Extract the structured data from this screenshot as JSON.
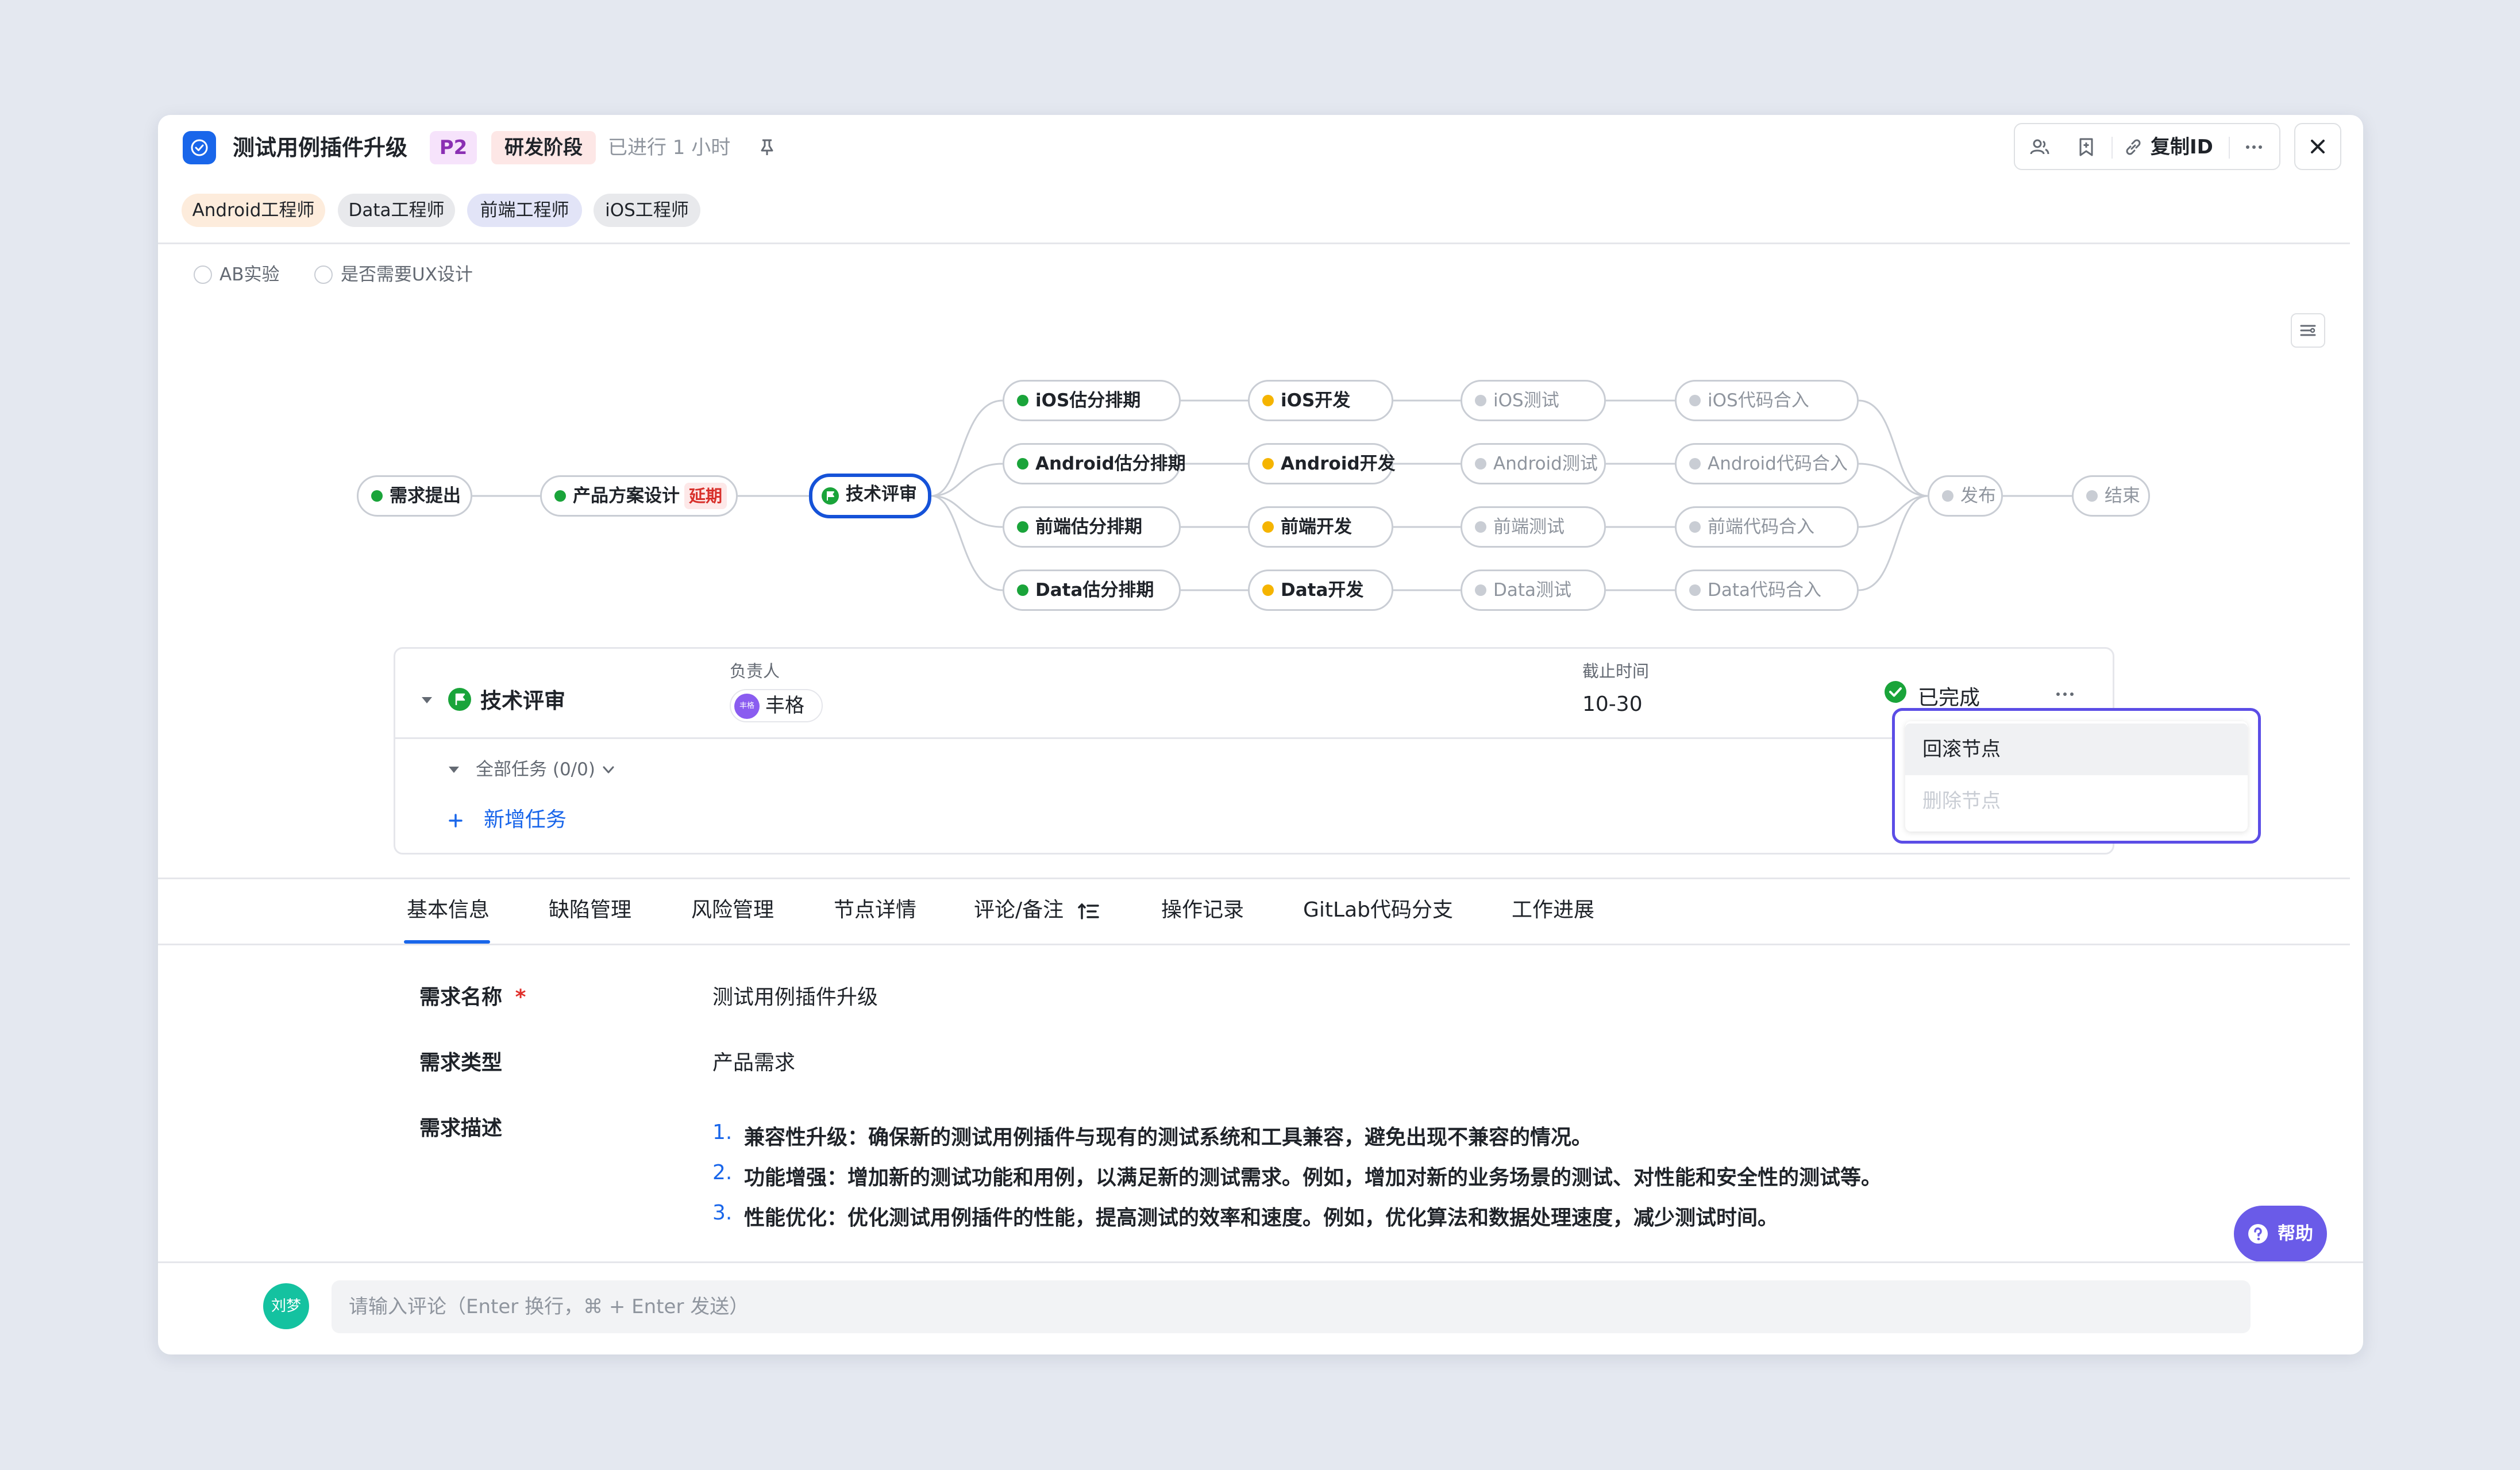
{
  "header": {
    "title": "测试用例插件升级",
    "priority": "P2",
    "stage": "研发阶段",
    "elapsed": "已进行 1 小时",
    "copy_id_label": "复制ID"
  },
  "role_tags": [
    "Android工程师",
    "Data工程师",
    "前端工程师",
    "iOS工程师"
  ],
  "options": {
    "ab_test": "AB实验",
    "ux_design": "是否需要UX设计"
  },
  "flow": {
    "nodes": [
      {
        "label": "需求提出",
        "status": "done"
      },
      {
        "label": "产品方案设计",
        "status": "done",
        "tag": "延期"
      },
      {
        "label": "技术评审",
        "status": "current"
      },
      {
        "label": "iOS估分排期",
        "status": "done"
      },
      {
        "label": "Android估分排期",
        "status": "done"
      },
      {
        "label": "前端估分排期",
        "status": "done"
      },
      {
        "label": "Data估分排期",
        "status": "done"
      },
      {
        "label": "iOS开发",
        "status": "in-progress"
      },
      {
        "label": "Android开发",
        "status": "in-progress"
      },
      {
        "label": "前端开发",
        "status": "in-progress"
      },
      {
        "label": "Data开发",
        "status": "in-progress"
      },
      {
        "label": "iOS测试",
        "status": "pending"
      },
      {
        "label": "Android测试",
        "status": "pending"
      },
      {
        "label": "前端测试",
        "status": "pending"
      },
      {
        "label": "Data测试",
        "status": "pending"
      },
      {
        "label": "iOS代码合入",
        "status": "pending"
      },
      {
        "label": "Android代码合入",
        "status": "pending"
      },
      {
        "label": "前端代码合入",
        "status": "pending"
      },
      {
        "label": "Data代码合入",
        "status": "pending"
      },
      {
        "label": "发布",
        "status": "pending"
      },
      {
        "label": "结束",
        "status": "pending"
      }
    ],
    "colors": {
      "done": "#1aa43a",
      "in-progress": "#f5b400",
      "pending": "#c9cdd4",
      "current_border": "#1552d8"
    }
  },
  "node_detail": {
    "name": "技术评审",
    "owner_label": "负责人",
    "owner_avatar": "丰格",
    "owner_name": "丰格",
    "deadline_label": "截止时间",
    "deadline": "10-30",
    "status": "已完成",
    "tasks_label": "全部任务 (0/0)",
    "add_task": "新增任务"
  },
  "context_menu": {
    "items": [
      {
        "label": "回滚节点",
        "disabled": false
      },
      {
        "label": "删除节点",
        "disabled": true
      }
    ]
  },
  "tabs": [
    "基本信息",
    "缺陷管理",
    "风险管理",
    "节点详情",
    "评论/备注",
    "操作记录",
    "GitLab代码分支",
    "工作进展"
  ],
  "active_tab": "基本信息",
  "basic_info": {
    "name_label": "需求名称",
    "required_mark": "*",
    "name_value": "测试用例插件升级",
    "type_label": "需求类型",
    "type_value": "产品需求",
    "desc_label": "需求描述",
    "desc_items": [
      "兼容性升级：确保新的测试用例插件与现有的测试系统和工具兼容，避免出现不兼容的情况。",
      "功能增强：增加新的测试功能和用例，以满足新的测试需求。例如，增加对新的业务场景的测试、对性能和安全性的测试等。",
      "性能优化：优化测试用例插件的性能，提高测试的效率和速度。例如，优化算法和数据处理速度，减少测试时间。"
    ]
  },
  "help_label": "帮助",
  "comment": {
    "avatar": "刘梦",
    "placeholder": "请输入评论（Enter 换行，⌘ + Enter 发送）"
  }
}
